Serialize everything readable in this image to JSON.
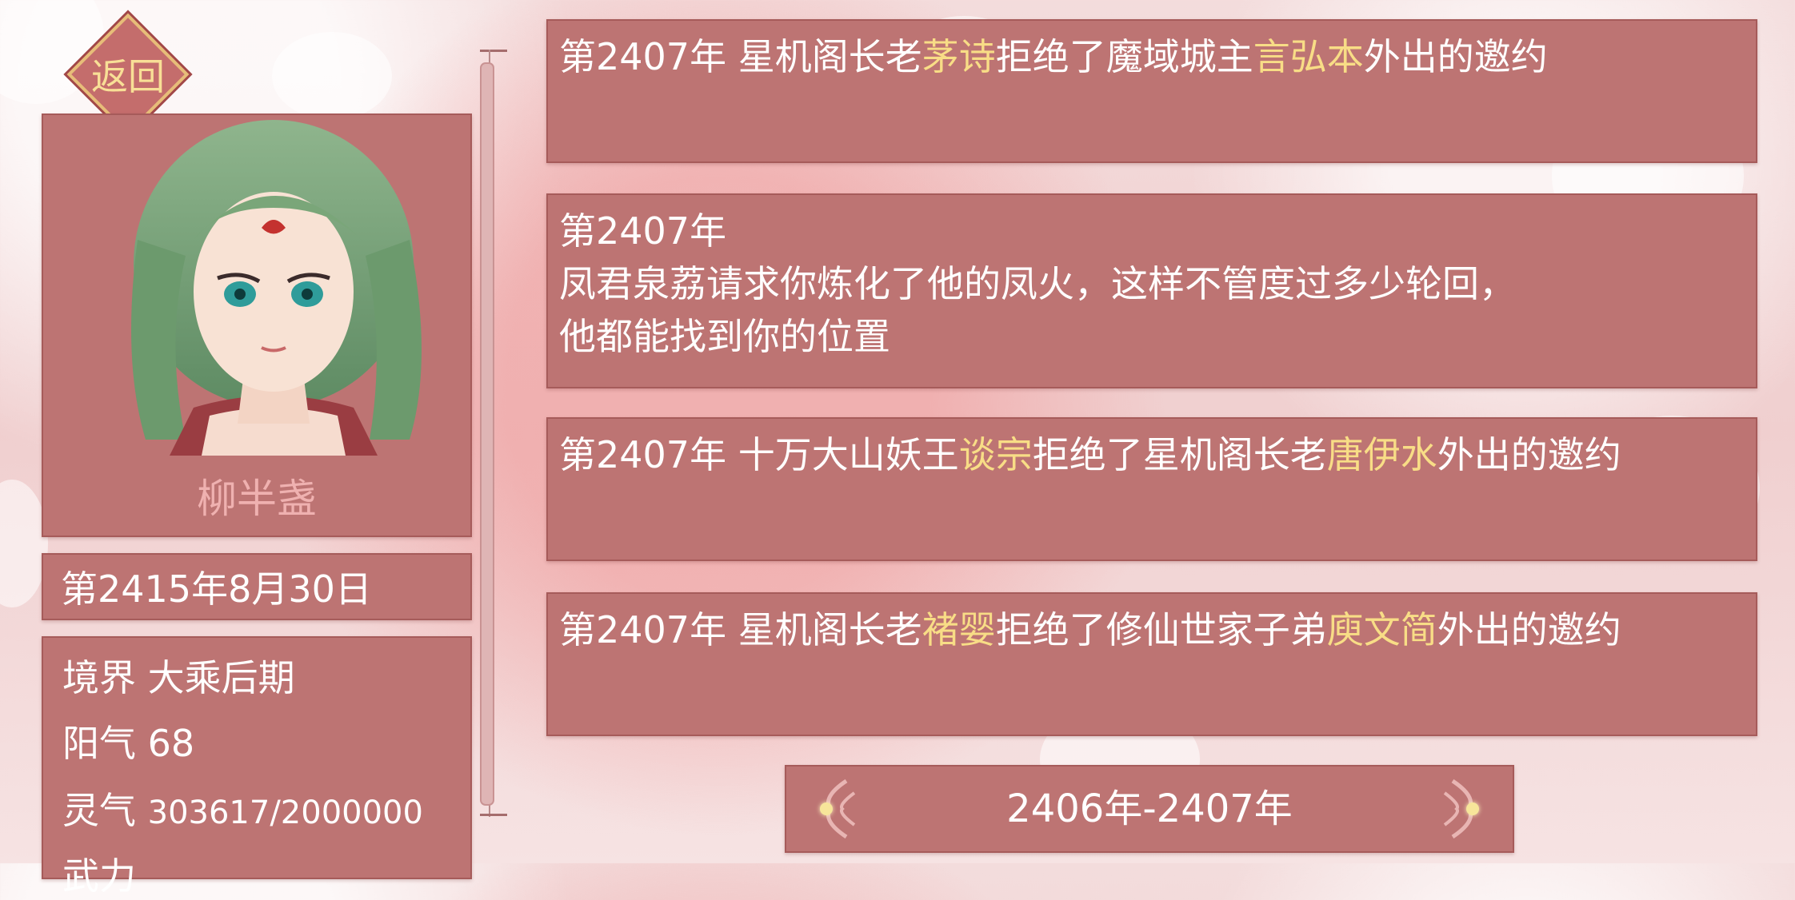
{
  "back_button": {
    "label": "返回"
  },
  "character": {
    "name": "柳半盏"
  },
  "current_date": "第2415年8月30日",
  "stats": {
    "realm_label": "境界",
    "realm_value": "大乘后期",
    "yang_label": "阳气",
    "yang_value": "68",
    "spirit_label": "灵气",
    "spirit_value": "303617/2000000",
    "next_label": "武力"
  },
  "entries": [
    {
      "year": "第2407年",
      "a": "星机阁长老",
      "b": "茅诗",
      "c": "拒绝了魔域城主",
      "d": "言弘本",
      "e": "外出的邀约"
    },
    {
      "year": "第2407年",
      "line2": "凤君泉荔请求你炼化了他的凤火，这样不管度过多少轮回，",
      "line3": "他都能找到你的位置"
    },
    {
      "year": "第2407年",
      "a": "十万大山妖王",
      "b": "谈宗",
      "c": "拒绝了星机阁长老",
      "d": "唐伊水",
      "e": "外出的邀约"
    },
    {
      "year": "第2407年",
      "a": "星机阁长老",
      "b": "褚婴",
      "c": "拒绝了修仙世家子弟",
      "d": "庾文简",
      "e": "外出的邀约"
    }
  ],
  "year_selector": {
    "label": "2406年-2407年"
  },
  "colors": {
    "panel": "#bd7473",
    "highlight": "#f8dd86",
    "name": "#efb1b0",
    "gold": "#e7bd79"
  }
}
